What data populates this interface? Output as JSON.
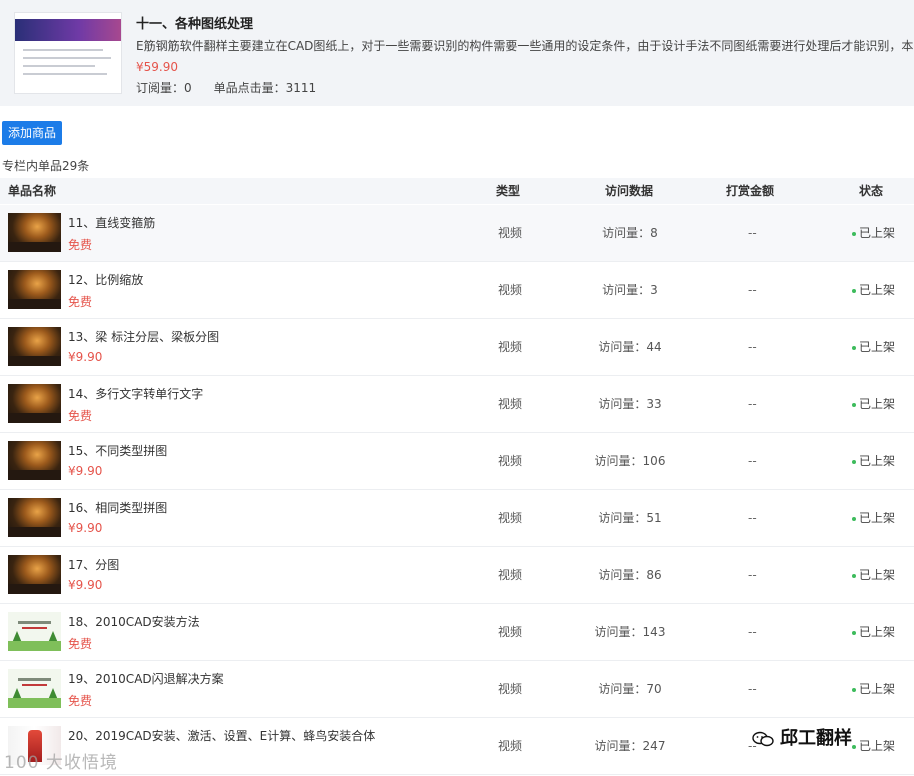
{
  "column": {
    "title": "十一、各种图纸处理",
    "description": "E筋钢筋软件翻样主要建立在CAD图纸上，对于一些需要识别的构件需要一些通用的设定条件，由于设计手法不同图纸需要进行处理后才能识别，本",
    "price": "¥59.90",
    "subscriptions": "订阅量：0",
    "clicks": "单品点击量：3111"
  },
  "toolbar": {
    "add_label": "添加商品",
    "count_text": "专栏内单品29条"
  },
  "table": {
    "headers": {
      "name": "单品名称",
      "type": "类型",
      "visits": "访问数据",
      "tip": "打赏金额",
      "status": "状态"
    },
    "rows": [
      {
        "name": "11、直线变箍筋",
        "price": "免费",
        "type": "视频",
        "visits": "访问量：8",
        "tip": "--",
        "status": "已上架",
        "thumb": "video"
      },
      {
        "name": "12、比例缩放",
        "price": "免费",
        "type": "视频",
        "visits": "访问量：3",
        "tip": "--",
        "status": "已上架",
        "thumb": "video"
      },
      {
        "name": "13、梁 标注分层、梁板分图",
        "price": "¥9.90",
        "type": "视频",
        "visits": "访问量：44",
        "tip": "--",
        "status": "已上架",
        "thumb": "video"
      },
      {
        "name": "14、多行文字转单行文字",
        "price": "免费",
        "type": "视频",
        "visits": "访问量：33",
        "tip": "--",
        "status": "已上架",
        "thumb": "video"
      },
      {
        "name": "15、不同类型拼图",
        "price": "¥9.90",
        "type": "视频",
        "visits": "访问量：106",
        "tip": "--",
        "status": "已上架",
        "thumb": "video"
      },
      {
        "name": "16、相同类型拼图",
        "price": "¥9.90",
        "type": "视频",
        "visits": "访问量：51",
        "tip": "--",
        "status": "已上架",
        "thumb": "video"
      },
      {
        "name": "17、分图",
        "price": "¥9.90",
        "type": "视频",
        "visits": "访问量：86",
        "tip": "--",
        "status": "已上架",
        "thumb": "video"
      },
      {
        "name": "18、2010CAD安装方法",
        "price": "免费",
        "type": "视频",
        "visits": "访问量：143",
        "tip": "--",
        "status": "已上架",
        "thumb": "green"
      },
      {
        "name": "19、2010CAD闪退解决方案",
        "price": "免费",
        "type": "视频",
        "visits": "访问量：70",
        "tip": "--",
        "status": "已上架",
        "thumb": "green"
      },
      {
        "name": "20、2019CAD安装、激活、设置、E计算、蜂鸟安装合体",
        "price": "",
        "type": "视频",
        "visits": "访问量：247",
        "tip": "--",
        "status": "已上架",
        "thumb": "red"
      }
    ]
  },
  "watermark": {
    "left": "100 大收悟境",
    "right": "邱工翻样"
  },
  "icons": {
    "wechat": "wechat-icon",
    "status_dot": "status-dot-icon"
  },
  "colors": {
    "accent": "#1c7ce8",
    "price": "#e5544b",
    "status_dot": "#3dbb5c"
  }
}
